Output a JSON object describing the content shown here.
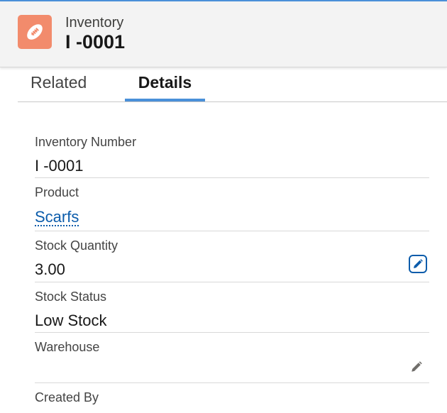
{
  "header": {
    "object_label": "Inventory",
    "record_name": "I -0001",
    "icon": "football-icon",
    "icon_color": "#f28b6c"
  },
  "tabs": [
    {
      "label": "Related",
      "active": false
    },
    {
      "label": "Details",
      "active": true
    }
  ],
  "accent_color": "#4a90d9",
  "link_color": "#0b5cab",
  "fields": [
    {
      "label": "Inventory Number",
      "value": "I -0001"
    },
    {
      "label": "Product",
      "value": "Scarfs",
      "is_link": true
    },
    {
      "label": "Stock Quantity",
      "value": "3.00",
      "edit_icon": "pencil-icon",
      "edit_focused": true
    },
    {
      "label": "Stock Status",
      "value": "Low Stock"
    },
    {
      "label": "Warehouse",
      "value": "",
      "edit_icon": "pencil-icon"
    },
    {
      "label": "Created By",
      "value": ""
    }
  ]
}
